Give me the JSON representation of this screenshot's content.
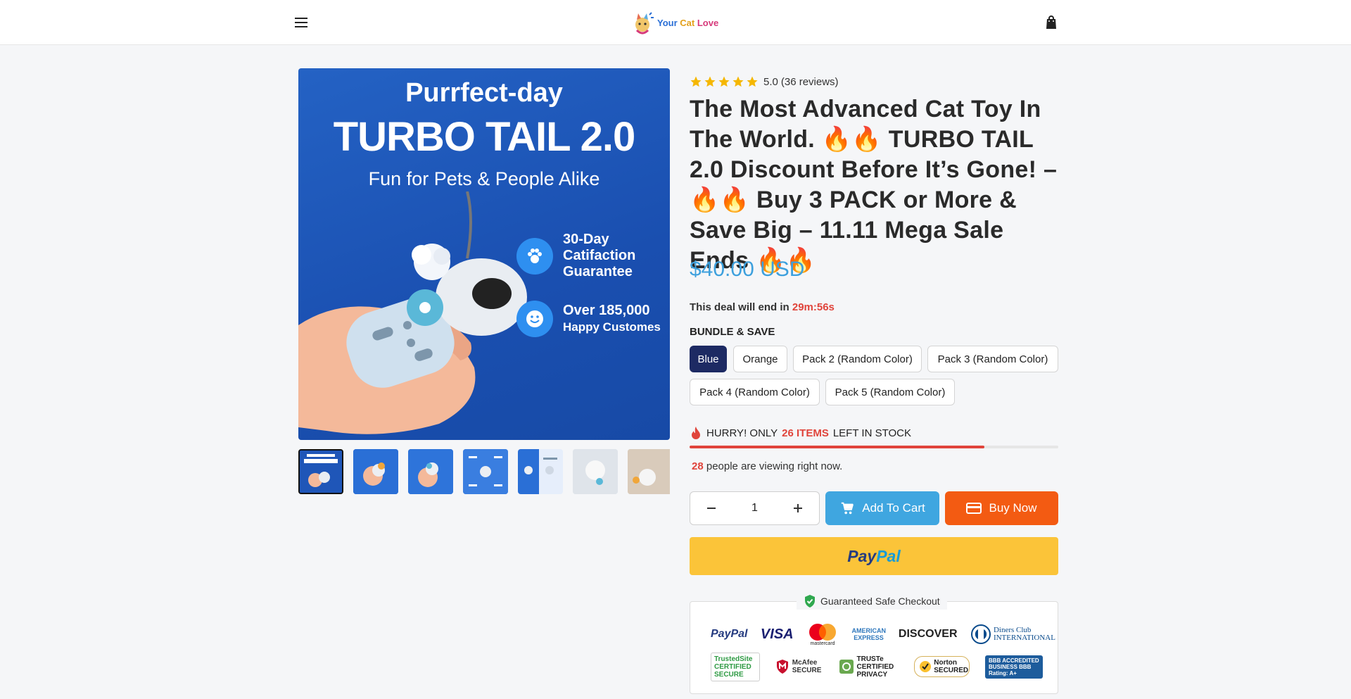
{
  "header": {
    "logo_text_1": "Your",
    "logo_text_2": "Cat",
    "logo_text_3": "Love"
  },
  "gallery": {
    "main_image": {
      "line1": "Purrfect-day",
      "line2": "TURBO TAIL 2.0",
      "line3": "Fun for Pets & People Alike",
      "badge1": "30-Day Catifaction Guarantee",
      "badge2_line1": "Over 185,000",
      "badge2_line2": "Happy Customes"
    },
    "thumb_count": 7,
    "active_thumb": 1
  },
  "product": {
    "rating_value": "5.0",
    "rating_reviews": "(36 reviews)",
    "star_count": 5,
    "title": "The Most Advanced Cat Toy In The World. 🔥🔥 TURBO TAIL 2.0 Discount Before It’s Gone! – 🔥🔥 Buy 3 PACK or More & Save Big – 11.11 Mega Sale Ends 🔥🔥",
    "price": "$40.00 USD",
    "deal_prefix": "This deal will end in",
    "deal_timer": "29m:56s",
    "bundle_label": "BUNDLE & SAVE",
    "variants": [
      {
        "label": "Blue",
        "selected": true
      },
      {
        "label": "Orange",
        "selected": false
      },
      {
        "label": "Pack 2 (Random Color)",
        "selected": false
      },
      {
        "label": "Pack 3 (Random Color)",
        "selected": false
      },
      {
        "label": "Pack 4 (Random Color)",
        "selected": false
      },
      {
        "label": "Pack 5 (Random Color)",
        "selected": false
      }
    ],
    "stock_prefix": "HURRY! ONLY",
    "stock_count": "26 ITEMS",
    "stock_suffix": "LEFT IN STOCK",
    "stock_level_fraction": 0.8,
    "viewers_count": "28",
    "viewers_text": "people are viewing right now.",
    "quantity": "1",
    "add_to_cart_label": "Add To Cart",
    "buy_now_label": "Buy Now",
    "paypal_label_1": "Pay",
    "paypal_label_2": "Pal"
  },
  "checkout": {
    "safe_checkout_title": "Guaranteed Safe Checkout",
    "payment_logos": [
      "PayPal",
      "VISA",
      "mastercard",
      "AMERICAN EXPRESS",
      "DISCOVER",
      "Diners Club INTERNATIONAL"
    ],
    "trust_logos": [
      "TrustedSite CERTIFIED SECURE",
      "McAfee SECURE",
      "TRUSTe CERTIFIED PRIVACY",
      "Norton SECURED",
      "BBB ACCREDITED BUSINESS BBB Rating: A+"
    ]
  },
  "colors": {
    "price": "#3da0dd",
    "accent_red": "#e0443b",
    "add_to_cart": "#3fa6e0",
    "buy_now": "#f35b12",
    "paypal": "#fbc439",
    "selected_variant": "#1d2a63",
    "star": "#f5b700"
  }
}
